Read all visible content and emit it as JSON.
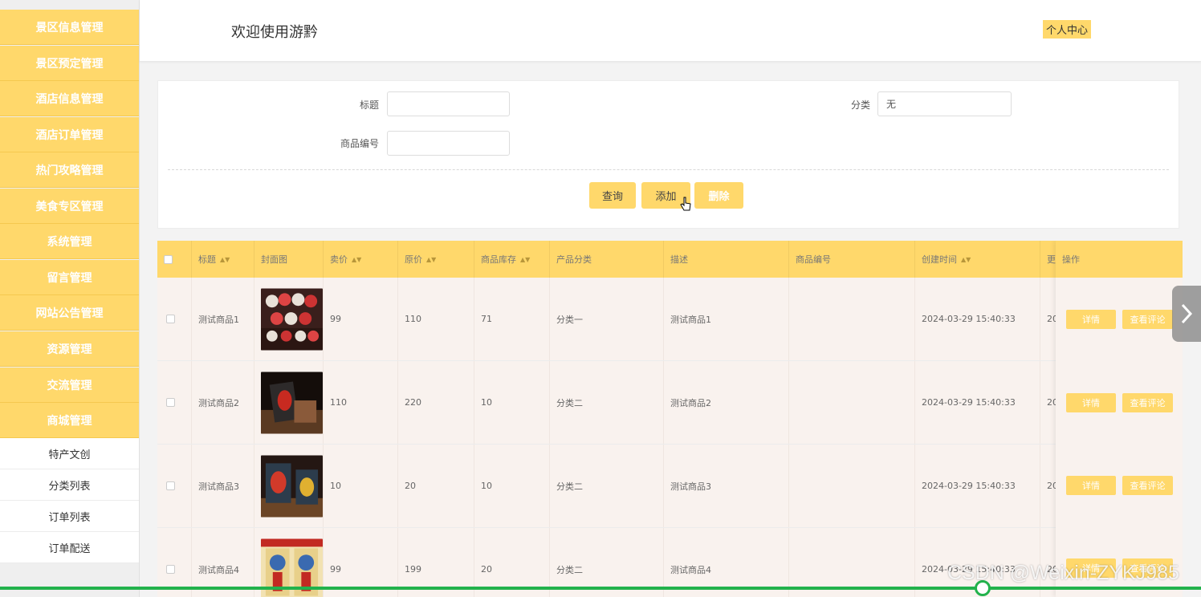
{
  "header": {
    "title": "欢迎使用游黔",
    "profile": "个人中心"
  },
  "sidebar": {
    "items": [
      "景区信息管理",
      "景区预定管理",
      "酒店信息管理",
      "酒店订单管理",
      "热门攻略管理",
      "美食专区管理",
      "系统管理",
      "留言管理",
      "网站公告管理",
      "资源管理",
      "交流管理",
      "商城管理"
    ],
    "subitems": [
      "特产文创",
      "分类列表",
      "订单列表",
      "订单配送"
    ]
  },
  "search": {
    "title_label": "标题",
    "title_value": "",
    "category_label": "分类",
    "category_value": "无",
    "code_label": "商品编号",
    "code_value": "",
    "query_btn": "查询",
    "add_btn": "添加",
    "delete_btn": "删除"
  },
  "table": {
    "columns": [
      "标题",
      "封面图",
      "卖价",
      "原价",
      "商品库存",
      "产品分类",
      "描述",
      "商品编号",
      "创建时间",
      "更",
      "操作"
    ],
    "rows": [
      {
        "title": "测试商品1",
        "price": "99",
        "original": "110",
        "stock": "71",
        "category": "分类一",
        "desc": "测试商品1",
        "code": "",
        "created": "2024-03-29 15:40:33",
        "updated": "20"
      },
      {
        "title": "测试商品2",
        "price": "110",
        "original": "220",
        "stock": "10",
        "category": "分类二",
        "desc": "测试商品2",
        "code": "",
        "created": "2024-03-29 15:40:33",
        "updated": "20"
      },
      {
        "title": "测试商品3",
        "price": "10",
        "original": "20",
        "stock": "10",
        "category": "分类二",
        "desc": "测试商品3",
        "code": "",
        "created": "2024-03-29 15:40:33",
        "updated": "20"
      },
      {
        "title": "测试商品4",
        "price": "99",
        "original": "199",
        "stock": "20",
        "category": "分类二",
        "desc": "测试商品4",
        "code": "",
        "created": "2024-03-29 15:40:33",
        "updated": "20"
      }
    ],
    "detail_btn": "详情",
    "review_btn": "查看评论"
  },
  "overlay": {
    "next_icon": "chevron-right-icon",
    "watermark": "CSDN @Weixin-ZYKJ985"
  },
  "colors": {
    "accent": "#ffd86b",
    "progress": "#22b24c"
  }
}
